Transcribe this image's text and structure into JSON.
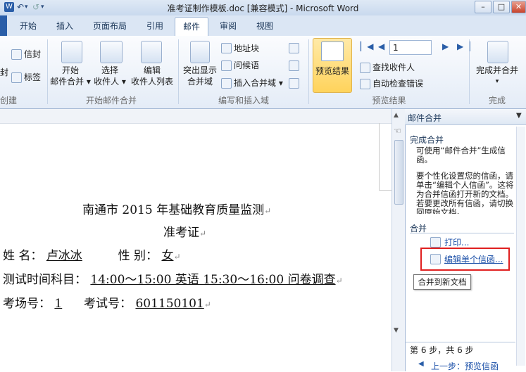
{
  "window": {
    "title": "准考证制作模板.doc [兼容模式] - Microsoft Word",
    "quick_access": [
      "↶",
      "▾",
      "↺",
      "▾"
    ],
    "controls": [
      "–",
      "□",
      "✕"
    ]
  },
  "tabs": [
    {
      "label": "开始"
    },
    {
      "label": "插入"
    },
    {
      "label": "页面布局"
    },
    {
      "label": "引用"
    },
    {
      "label": "邮件"
    },
    {
      "label": "审阅"
    },
    {
      "label": "视图"
    }
  ],
  "ribbon": {
    "create_group": {
      "items": [
        "信封",
        "标签"
      ],
      "left_fragment": "封",
      "label": "创建"
    },
    "start_group": {
      "start_merge": {
        "line1": "开始",
        "line2": "邮件合并 ▾"
      },
      "select_recipients": {
        "line1": "选择",
        "line2": "收件人 ▾"
      },
      "edit_list": {
        "line1": "编辑",
        "line2": "收件人列表"
      },
      "label": "开始邮件合并"
    },
    "write_group": {
      "highlight_fields": {
        "line1": "突出显示",
        "line2": "合并域"
      },
      "items": [
        "地址块",
        "问候语",
        "插入合并域 ▾"
      ],
      "label": "编写和插入域"
    },
    "preview_group": {
      "preview_results": "预览结果",
      "record_value": "1",
      "find_recipient": "查找收件人",
      "auto_check": "自动检查错误",
      "label": "预览结果"
    },
    "finish_group": {
      "finish_merge": "完成并合并",
      "label": "完成"
    }
  },
  "document": {
    "heading1": "南通市 2015 年基础教育质量监测",
    "heading2": "准考证",
    "line_name": {
      "label1": "姓  名：",
      "name": "卢冰冰",
      "label2": "性  别：",
      "gender": "女"
    },
    "line_time": {
      "label": "测试时间科目：",
      "value": "14:00～15:00  英语  15:30～16:00  问卷调查"
    },
    "line_room": {
      "label1": "考场号：",
      "room": "1",
      "label2": "考试号：",
      "exam_no": "601150101"
    }
  },
  "task_pane": {
    "title": "邮件合并",
    "section_complete": "完成合并",
    "desc1": "可使用“邮件合并”生成信函。",
    "desc2": "要个性化设置您的信函，请单击“编辑个人信函”。这将为合并信函打开新的文档。若要更改所有信函，请切换回原始文档。",
    "section_merge": "合并",
    "print_link": "打印...",
    "edit_link": "编辑单个信函...",
    "tooltip": "合并到新文档",
    "step": "第 6 步，共 6 步",
    "prev_link": "上一步：预览信函"
  }
}
